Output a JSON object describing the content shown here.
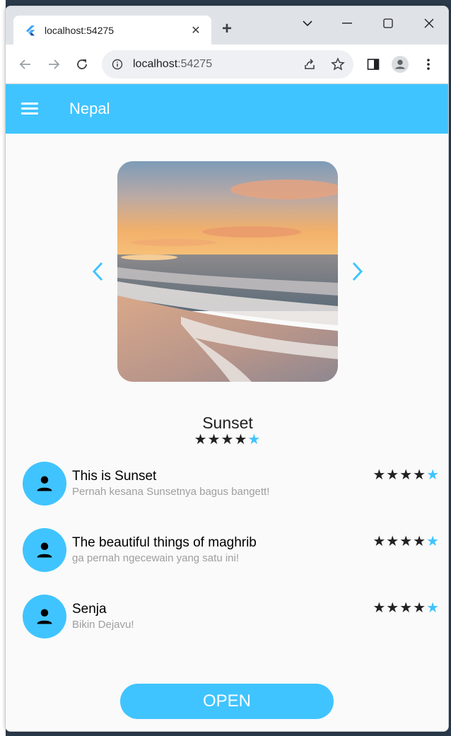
{
  "browser": {
    "tab_title": "localhost:54275",
    "url_host": "localhost",
    "url_port": ":54275"
  },
  "app": {
    "title": "Nepal",
    "accent": "#40c4ff"
  },
  "place": {
    "name": "Sunset",
    "rating": 5,
    "image": "beach sunset photo"
  },
  "reviews": [
    {
      "title": "This is Sunset",
      "comment": "Pernah kesana Sunsetnya bagus bangett!",
      "rating": 5
    },
    {
      "title": "The beautiful things of maghrib",
      "comment": "ga pernah ngecewain yang satu ini!",
      "rating": 5
    },
    {
      "title": "Senja",
      "comment": "Bikin Dejavu!",
      "rating": 5
    }
  ],
  "actions": {
    "open_label": "OPEN"
  },
  "stars": {
    "glyph": "★★★★",
    "last": "★"
  }
}
